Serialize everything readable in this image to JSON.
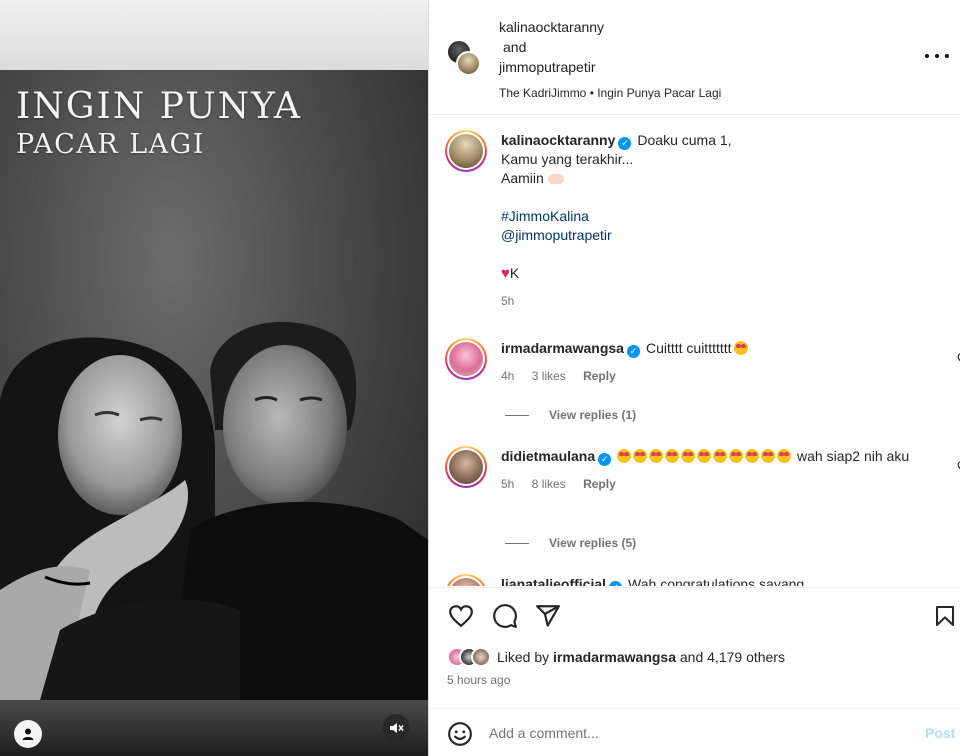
{
  "media": {
    "overlay_line1": "INGIN PUNYA",
    "overlay_line2": "PACAR LAGI",
    "icons": [
      "person-icon",
      "muted-speaker-icon"
    ]
  },
  "header": {
    "user1": "kalinaocktaranny",
    "and": "and",
    "user2": "jimmoputrapetir",
    "audio": "The KadriJimmo • Ingin Punya Pacar Lagi",
    "more_icon": "more-horizontal-icon"
  },
  "caption": {
    "username": "kalinaocktaranny",
    "line1": "Doaku cuma 1,",
    "line2": "Kamu yang terakhir...",
    "line3": "Aamiin",
    "hashtag": "#JimmoKalina",
    "mention": "@jimmoputrapetir",
    "sign": "K",
    "time": "5h"
  },
  "comments": [
    {
      "username": "irmadarmawangsa",
      "text": "Cuitttt cuittttttt",
      "time": "4h",
      "likes": "3 likes",
      "reply": "Reply",
      "view_replies": "View replies (1)"
    },
    {
      "username": "didietmaulana",
      "text": "wah siap2 nih aku",
      "time": "5h",
      "likes": "8 likes",
      "reply": "Reply",
      "view_replies": "View replies (5)"
    }
  ],
  "partial_comment": {
    "username": "lianatalieofficial",
    "text": "Wah congratulations sayang"
  },
  "actions": {
    "icons": [
      "heart-icon",
      "comment-icon",
      "share-icon",
      "bookmark-icon"
    ]
  },
  "likes": {
    "liked_by": "Liked by",
    "user": "irmadarmawangsa",
    "rest": "and 4,179 others"
  },
  "time_ago": "5 hours ago",
  "add_comment": {
    "placeholder": "Add a comment...",
    "post_label": "Post"
  },
  "colors": {
    "link": "#00376b",
    "verified": "#0095f6",
    "muted_text": "#737373",
    "post_disabled": "#b3dbff"
  }
}
